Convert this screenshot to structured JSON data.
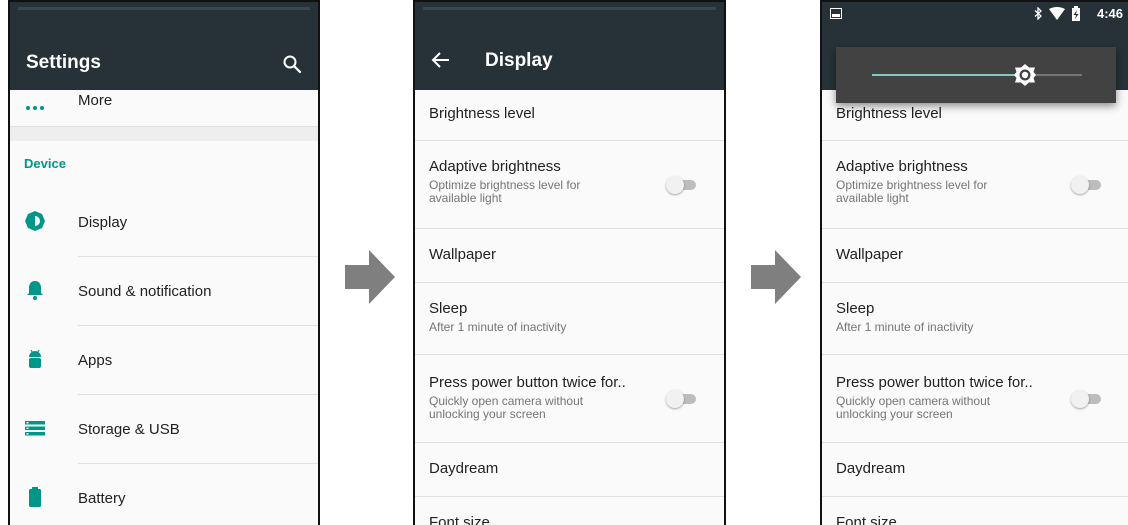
{
  "settings": {
    "title": "Settings",
    "more_label": "More",
    "section": "Device",
    "items": [
      {
        "label": "Display",
        "icon": "brightness-icon"
      },
      {
        "label": "Sound & notification",
        "icon": "bell-icon"
      },
      {
        "label": "Apps",
        "icon": "android-icon"
      },
      {
        "label": "Storage & USB",
        "icon": "storage-icon"
      },
      {
        "label": "Battery",
        "icon": "battery-icon"
      }
    ]
  },
  "display": {
    "title": "Display",
    "rows": [
      {
        "title": "Brightness level",
        "summary": ""
      },
      {
        "title": "Adaptive brightness",
        "summary": "Optimize brightness level for available light"
      },
      {
        "title": "Wallpaper",
        "summary": ""
      },
      {
        "title": "Sleep",
        "summary": "After 1 minute of inactivity"
      },
      {
        "title": "Press power button twice for..",
        "summary": "Quickly open camera without unlocking your screen"
      },
      {
        "title": "Daydream",
        "summary": ""
      },
      {
        "title": "Font size",
        "summary": ""
      }
    ]
  },
  "popup": {
    "time": "4:46",
    "brightness_level": 0.73
  },
  "colors": {
    "toolbar": "#263238",
    "accent": "#009688"
  }
}
